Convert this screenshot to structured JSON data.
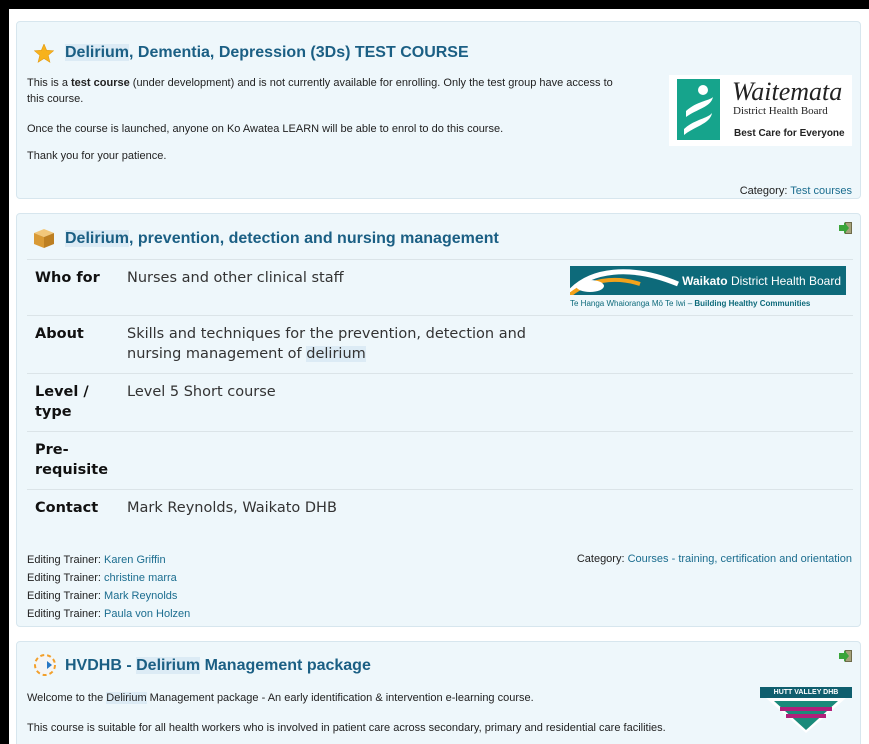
{
  "courses": [
    {
      "title_hl": "Delirium",
      "title_rest": ", Dementia, Depression (3Ds) TEST COURSE",
      "icon": "star-icon",
      "summary": {
        "p1_a": "This is a ",
        "p1_b": "test course",
        "p1_c": " (under development) and is not currently available for enrolling. Only the test group have access to",
        "p1_d": "this course.",
        "p2": "Once the course is launched, anyone on Ko Awatea LEARN will be able to enrol to do this course.",
        "p3": "Thank you for your patience."
      },
      "logo": {
        "name": "Waitemata",
        "sub": "District Health Board",
        "tagline": "Best Care for Everyone"
      },
      "category_label": "Category:",
      "category": "Test courses"
    },
    {
      "title_hl": "Delirium",
      "title_rest": ", prevention, detection and nursing management",
      "icon": "box-icon",
      "rows": [
        {
          "label": "Who for",
          "value": "Nurses and other clinical staff"
        },
        {
          "label": "About",
          "value_a": "Skills and techniques for the prevention, detection and",
          "value_b": "nursing management of ",
          "value_hl": "delirium"
        },
        {
          "label_a": "Level /",
          "label_b": "type",
          "value": "Level 5 Short course"
        },
        {
          "label_a": "Pre-",
          "label_b": "requisite",
          "value": ""
        },
        {
          "label": "Contact",
          "value": "Mark Reynolds, Waikato DHB"
        }
      ],
      "logo": {
        "name_bold": "Waikato",
        "name_rest": " District Health Board",
        "tagline_a": "Te Hanga Whaioranga Mō Te Iwi – ",
        "tagline_b": "Building Healthy Communities"
      },
      "trainers": [
        {
          "role": "Editing Trainer:",
          "name": "Karen Griffin"
        },
        {
          "role": "Editing Trainer:",
          "name": "christine marra"
        },
        {
          "role": "Editing Trainer:",
          "name": "Mark Reynolds"
        },
        {
          "role": "Editing Trainer:",
          "name": "Paula von Holzen"
        }
      ],
      "category_label": "Category:",
      "category": "Courses - training, certification and orientation"
    },
    {
      "title_a": "HVDHB - ",
      "title_hl": "Delirium",
      "title_rest": " Management package",
      "icon": "course-icon",
      "p1_a": "Welcome to the ",
      "p1_hl": "Delirium",
      "p1_b": " Management package - An early identification & intervention e-learning course.",
      "p2": "This course is suitable for all health workers who is involved in patient care across secondary, primary and residential care facilities.",
      "logo": {
        "name": "HUTT VALLEY DHB"
      }
    }
  ]
}
